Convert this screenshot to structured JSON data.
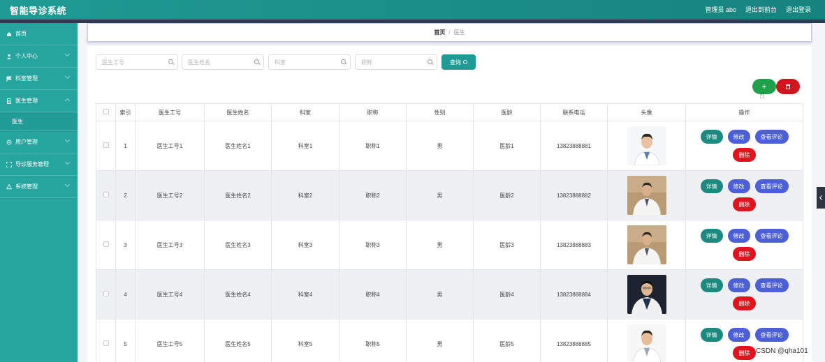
{
  "app": {
    "title": "智能导诊系统",
    "user_label": "管理员 abo",
    "back_label": "退出到前台",
    "logout_label": "退出登录"
  },
  "sidebar": {
    "items": [
      {
        "label": "首页",
        "icon": "home-icon"
      },
      {
        "label": "个人中心",
        "icon": "user-icon"
      },
      {
        "label": "科室管理",
        "icon": "flag-icon"
      },
      {
        "label": "医生管理",
        "icon": "doc-icon"
      },
      {
        "label": "用户管理",
        "icon": "users-icon"
      },
      {
        "label": "导诊服务管理",
        "icon": "expand-icon"
      },
      {
        "label": "系统管理",
        "icon": "settings-icon"
      }
    ],
    "sub_item": "医生"
  },
  "breadcrumb": {
    "home": "首页",
    "separator": "/",
    "current": "医生"
  },
  "search": {
    "fields": [
      {
        "placeholder": "医生工号"
      },
      {
        "placeholder": "医生姓名"
      },
      {
        "placeholder": "科室"
      },
      {
        "placeholder": "职称"
      }
    ],
    "button_label": "查询"
  },
  "toolbar": {
    "add_label": "+"
  },
  "table": {
    "headers": [
      "索引",
      "医生工号",
      "医生姓名",
      "科室",
      "职称",
      "性别",
      "医龄",
      "联系电话",
      "头像",
      "操作"
    ],
    "rows": [
      {
        "index": "1",
        "doctor_id": "医生工号1",
        "name": "医生姓名1",
        "department": "科室1",
        "title": "职称1",
        "gender": "男",
        "age": "医龄1",
        "phone": "13823888881"
      },
      {
        "index": "2",
        "doctor_id": "医生工号2",
        "name": "医生姓名2",
        "department": "科室2",
        "title": "职称2",
        "gender": "男",
        "age": "医龄2",
        "phone": "13823888882"
      },
      {
        "index": "3",
        "doctor_id": "医生工号3",
        "name": "医生姓名3",
        "department": "科室3",
        "title": "职称3",
        "gender": "男",
        "age": "医龄3",
        "phone": "13823888883"
      },
      {
        "index": "4",
        "doctor_id": "医生工号4",
        "name": "医生姓名4",
        "department": "科室4",
        "title": "职称4",
        "gender": "男",
        "age": "医龄4",
        "phone": "13823888884"
      },
      {
        "index": "5",
        "doctor_id": "医生工号5",
        "name": "医生姓名5",
        "department": "科室5",
        "title": "职称5",
        "gender": "男",
        "age": "医龄5",
        "phone": "13823888885"
      }
    ],
    "actions": {
      "detail": "详情",
      "edit": "修改",
      "review": "查看评论",
      "delete": "删除"
    }
  },
  "watermark": "CSDN @qha101",
  "colors": {
    "primary": "#1f9a94",
    "sidebar": "#26a59f",
    "add": "#1fa04a",
    "danger": "#d0151c",
    "edit": "#4c5fd6"
  }
}
